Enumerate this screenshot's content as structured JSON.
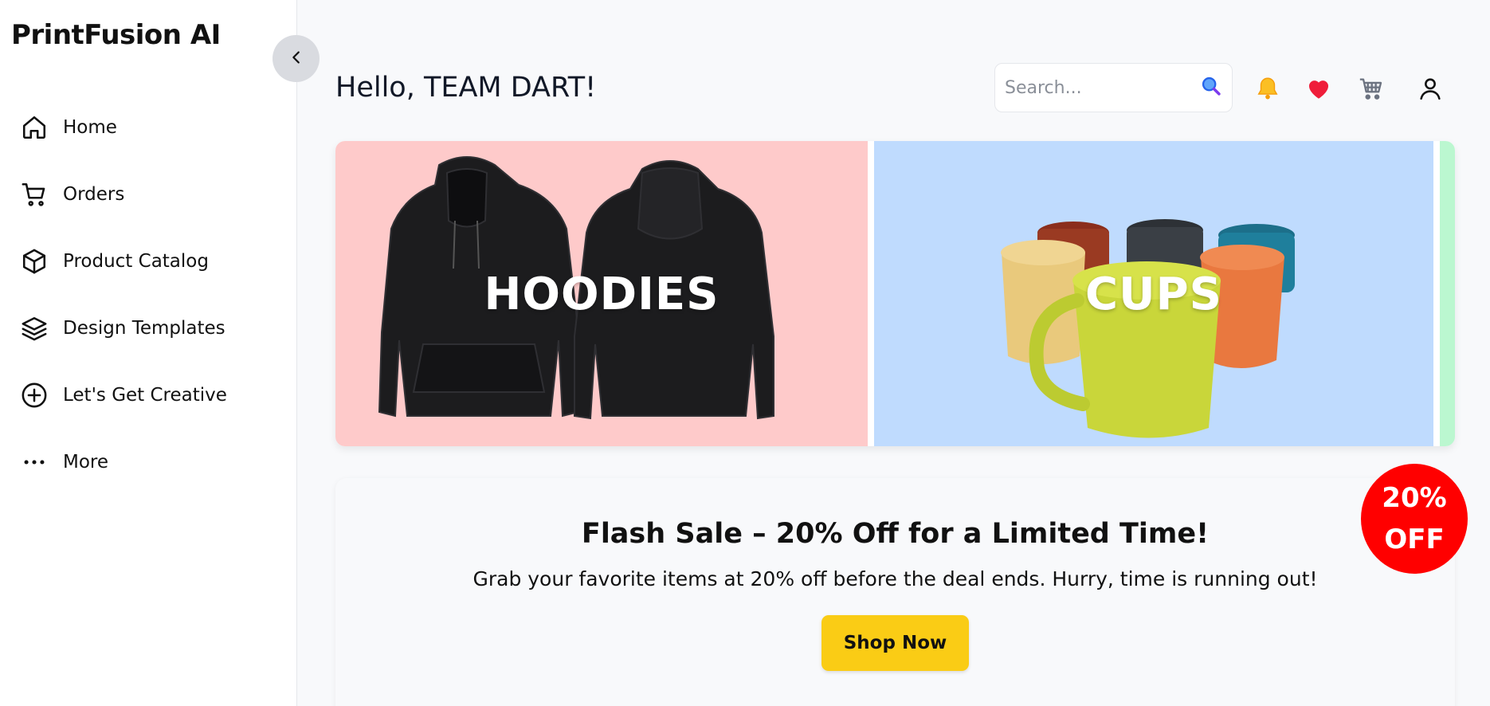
{
  "sidebar": {
    "brand": "PrintFusion AI",
    "items": [
      {
        "label": "Home",
        "icon": "home-icon"
      },
      {
        "label": "Orders",
        "icon": "cart-icon"
      },
      {
        "label": "Product Catalog",
        "icon": "box-icon"
      },
      {
        "label": "Design Templates",
        "icon": "layers-icon"
      },
      {
        "label": "Let's Get Creative",
        "icon": "plus-circle-icon"
      },
      {
        "label": "More",
        "icon": "more-dots-icon"
      }
    ]
  },
  "header": {
    "greeting": "Hello, TEAM DART!",
    "search_placeholder": "Search...",
    "icons": [
      "search-icon",
      "bell-icon",
      "heart-icon",
      "shopping-cart-icon",
      "user-icon"
    ]
  },
  "carousel": {
    "slides": [
      {
        "label": "HOODIES",
        "color": "#fecaca"
      },
      {
        "label": "CUPS",
        "color": "#bfdbfe"
      },
      {
        "label": "",
        "color": "#bbf7d0"
      }
    ]
  },
  "promo": {
    "title": "Flash Sale – 20% Off for a Limited Time!",
    "text": "Grab your favorite items at 20% off before the deal ends. Hurry, time is running out!",
    "button_label": "Shop Now",
    "badge_line1": "20%",
    "badge_line2": "OFF",
    "button_color": "#facc15",
    "badge_color": "#ff0000"
  }
}
